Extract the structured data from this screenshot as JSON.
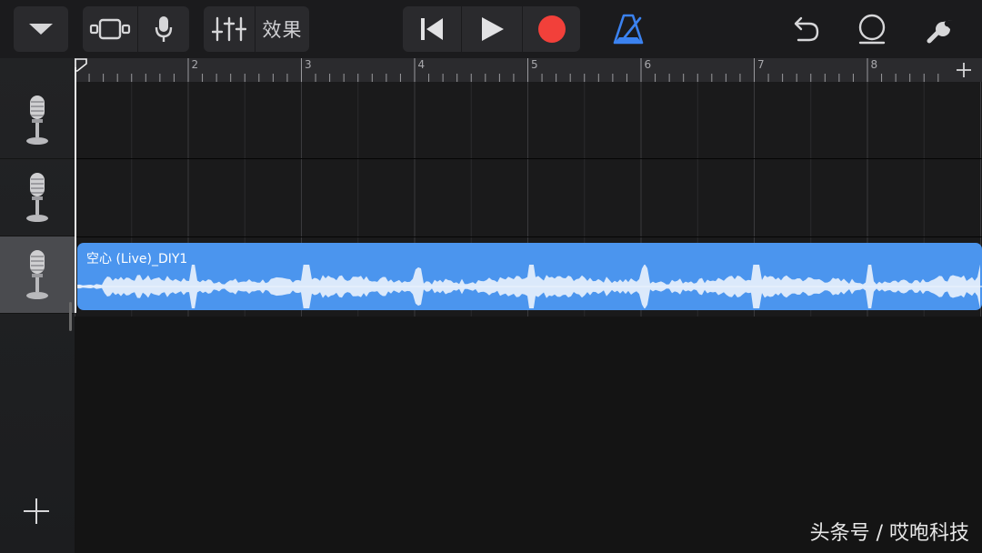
{
  "toolbar": {
    "effects_label": "效果",
    "colors": {
      "record": "#f2403a",
      "metronome": "#3b82f0"
    }
  },
  "ruler": {
    "bar_numbers": [
      "2",
      "3",
      "4",
      "5",
      "6",
      "7",
      "8"
    ]
  },
  "tracks": [
    {
      "instrument_icon": "microphone-icon",
      "selected": false
    },
    {
      "instrument_icon": "microphone-icon",
      "selected": false
    },
    {
      "instrument_icon": "microphone-icon",
      "selected": true
    }
  ],
  "region": {
    "title": "空心 (Live)_DIY1",
    "color": "#4b95ee"
  },
  "watermark": "头条号 / 哎咆科技"
}
